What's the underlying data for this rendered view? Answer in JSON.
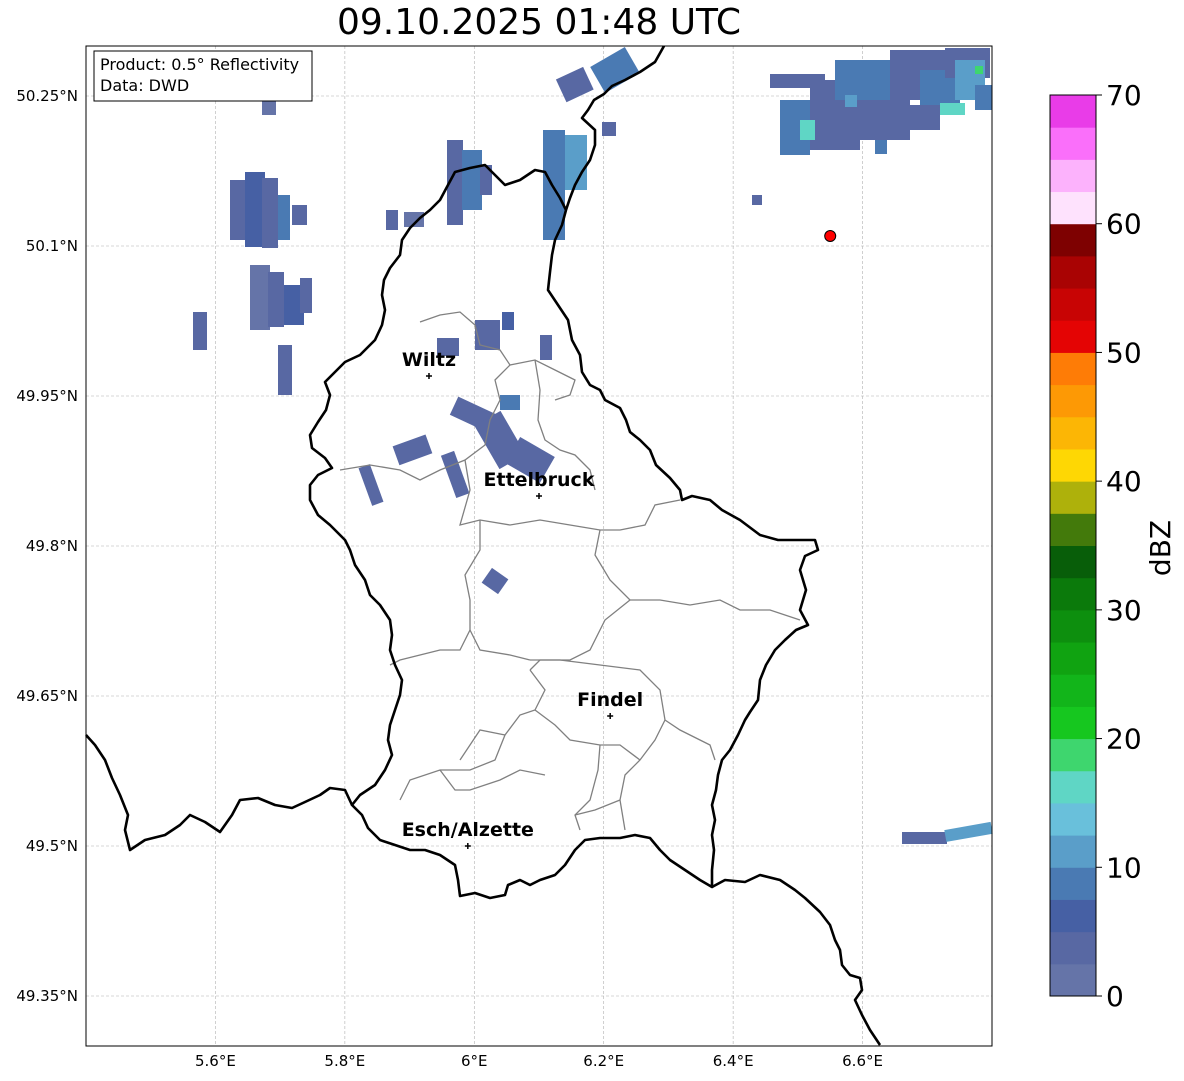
{
  "title": "09.10.2025 01:48 UTC",
  "info_box": {
    "product": "Product: 0.5° Reflectivity",
    "data": "Data: DWD"
  },
  "axes": {
    "lon_ticks": [
      "5.6°E",
      "5.8°E",
      "6°E",
      "6.2°E",
      "6.4°E",
      "6.6°E"
    ],
    "lat_ticks": [
      "50.25°N",
      "50.1°N",
      "49.95°N",
      "49.8°N",
      "49.65°N",
      "49.5°N",
      "49.35°N"
    ],
    "lon_range": [
      5.4,
      6.8
    ],
    "lat_range": [
      49.3,
      50.3
    ]
  },
  "cities": [
    {
      "name": "Wiltz",
      "lon": 5.93,
      "lat": 49.97
    },
    {
      "name": "Ettelbruck",
      "lon": 6.1,
      "lat": 49.85
    },
    {
      "name": "Findel",
      "lon": 6.21,
      "lat": 49.63
    },
    {
      "name": "Esch/Alzette",
      "lon": 5.99,
      "lat": 49.5
    }
  ],
  "radar_marker": {
    "lon": 6.55,
    "lat": 50.11,
    "color": "#ff0000"
  },
  "colorbar": {
    "label": "dBZ",
    "ticks": [
      "0",
      "10",
      "20",
      "30",
      "40",
      "50",
      "60",
      "70"
    ],
    "colors": [
      "#6574a8",
      "#5868a3",
      "#4660a4",
      "#4a7ab3",
      "#5a9ec9",
      "#69c0db",
      "#5fd6c5",
      "#3ed66e",
      "#16c71f",
      "#12b51a",
      "#10a311",
      "#0d8f0e",
      "#0b7a0b",
      "#085e09",
      "#437a0b",
      "#aeb10b",
      "#fed704",
      "#fcb605",
      "#fd9905",
      "#fe7c06",
      "#e40404",
      "#c80404",
      "#a90303",
      "#7e0101",
      "#fee2fd",
      "#fcb2fc",
      "#fa6ffa",
      "#e93ce8"
    ]
  }
}
